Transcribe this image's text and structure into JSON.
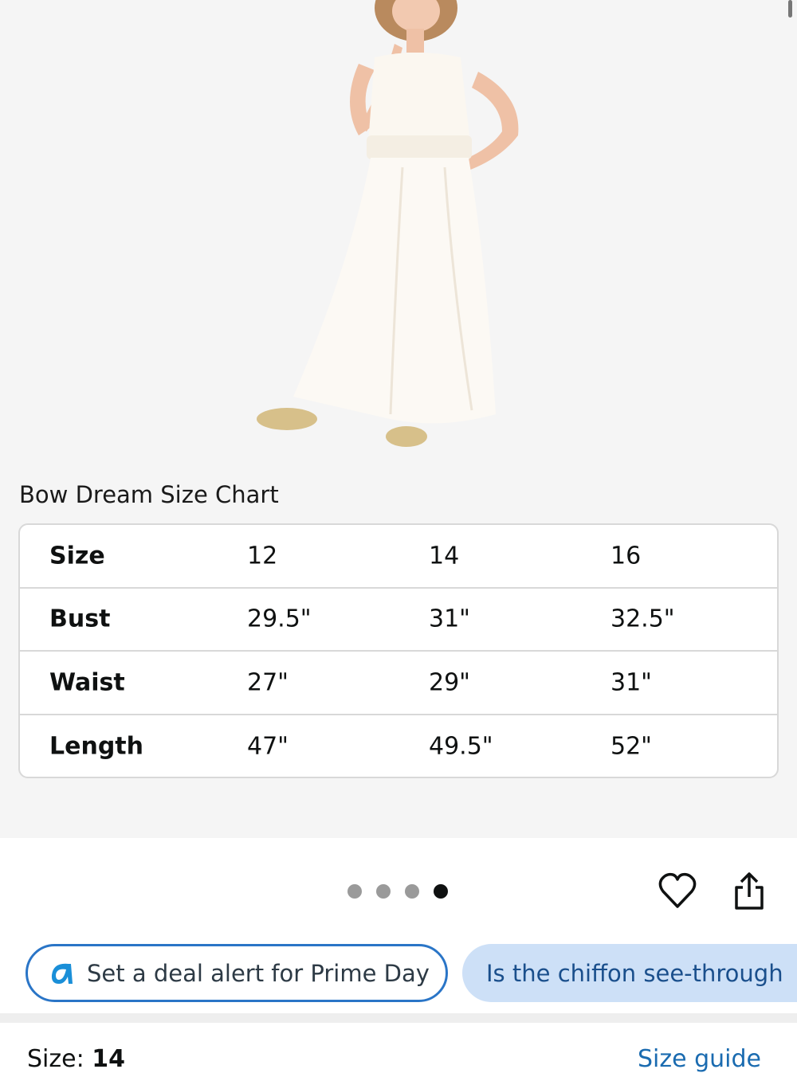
{
  "gallery": {
    "image_alt": "Girl in white chiffon maxi dress",
    "dots": {
      "count": 4,
      "active_index": 3
    }
  },
  "size_chart": {
    "title": "Bow Dream Size Chart",
    "rows": [
      {
        "label": "Size",
        "values": [
          "12",
          "14",
          "16"
        ]
      },
      {
        "label": "Bust",
        "values": [
          "29.5\"",
          "31\"",
          "32.5\""
        ]
      },
      {
        "label": "Waist",
        "values": [
          "27\"",
          "29\"",
          "31\""
        ]
      },
      {
        "label": "Length",
        "values": [
          "47\"",
          "49.5\"",
          "52\""
        ]
      }
    ]
  },
  "actions": {
    "heart_icon": "heart-outline-icon",
    "share_icon": "share-icon"
  },
  "chips": {
    "deal_alert": "Set a deal alert for Prime Day",
    "question": "Is the chiffon see-through"
  },
  "size_section": {
    "label": "Size: ",
    "value": "14",
    "guide_link": "Size guide"
  },
  "colors": {
    "gallery_bg": "#f5f5f5",
    "chip_border": "#2a75c7",
    "chip_fill": "#cde0f7",
    "link": "#1a6bb0"
  }
}
